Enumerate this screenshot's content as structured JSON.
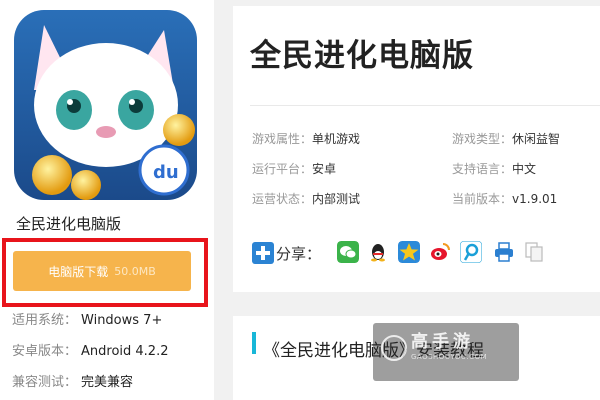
{
  "app": {
    "name": "全民进化电脑版",
    "download": {
      "label": "电脑版下载",
      "size": "50.0MB"
    },
    "info": [
      {
        "key": "适用系统：",
        "value": "Windows 7+"
      },
      {
        "key": "安卓版本：",
        "value": "Android 4.2.2"
      },
      {
        "key": "兼容测试：",
        "value": "完美兼容"
      }
    ]
  },
  "detail": {
    "title": "全民进化电脑版",
    "attributes": [
      {
        "key": "游戏属性：",
        "value": "单机游戏"
      },
      {
        "key": "游戏类型：",
        "value": "休闲益智"
      },
      {
        "key": "运行平台：",
        "value": "安卓"
      },
      {
        "key": "支持语言：",
        "value": "中文"
      },
      {
        "key": "运营状态：",
        "value": "内部测试"
      },
      {
        "key": "当前版本：",
        "value": "v1.9.01"
      }
    ],
    "share_label": "分享："
  },
  "tutorial": {
    "title": "《全民进化电脑版》安装教程"
  },
  "watermark": {
    "text": "高手游",
    "sub": "GAOSHOUYOU.COM"
  },
  "icons": [
    "plus-icon",
    "wechat-icon",
    "qq-icon",
    "qzone-icon",
    "weibo-icon",
    "tencent-weibo-icon",
    "print-icon",
    "copy-icon",
    "baidu-du-badge"
  ],
  "colors": {
    "download": "#f6b44c",
    "highlight": "#e8141b",
    "accent": "#18b7d8"
  }
}
